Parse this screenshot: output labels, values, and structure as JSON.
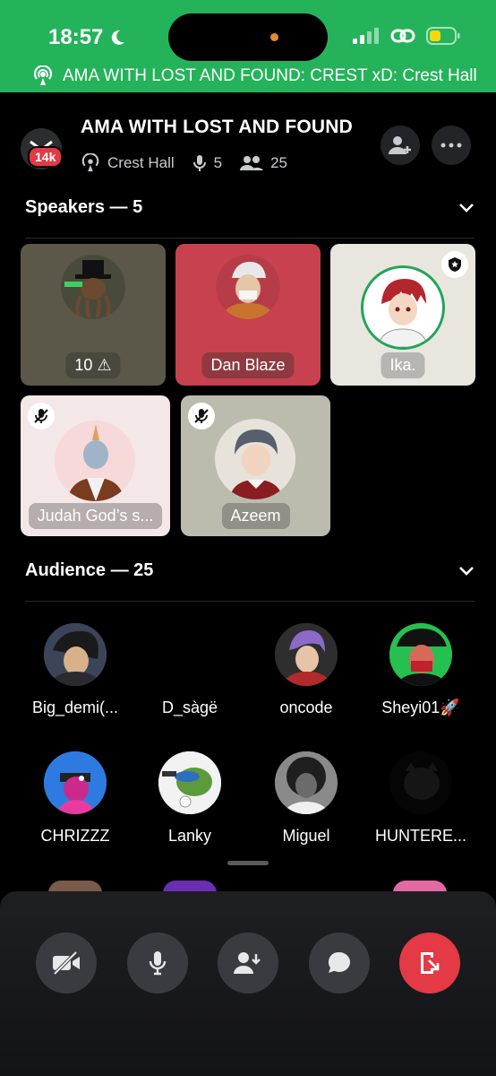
{
  "status_bar": {
    "time": "18:57"
  },
  "banner": {
    "text": "AMA WITH LOST AND FOUND: CREST xD: Crest Hall"
  },
  "header": {
    "server_badge": "14k",
    "title": "AMA WITH LOST AND FOUND",
    "channel": "Crest Hall",
    "speaker_count": "5",
    "listener_count": "25"
  },
  "speakers": {
    "heading": "Speakers — 5",
    "items": [
      {
        "name": "10 ⚠"
      },
      {
        "name": "Dan Blaze"
      },
      {
        "name": "Ika."
      },
      {
        "name": "Judah God’s s..."
      },
      {
        "name": "Azeem"
      }
    ]
  },
  "audience": {
    "heading": "Audience — 25",
    "items": [
      {
        "name": "Big_demi(..."
      },
      {
        "name": "D_sàgë"
      },
      {
        "name": "oncode"
      },
      {
        "name": "Sheyi01🚀"
      },
      {
        "name": "CHRIZZZ"
      },
      {
        "name": "Lanky"
      },
      {
        "name": "Miguel"
      },
      {
        "name": "HUNTERE..."
      }
    ]
  },
  "colors": {
    "banner_green": "#24b35a",
    "leave_red": "#e33a45",
    "badge_red": "#e33a45"
  },
  "icons": [
    "moon-icon",
    "signal-icon",
    "link-icon",
    "battery-icon",
    "stage-icon",
    "mic-icon",
    "people-icon",
    "add-person-icon",
    "more-icon",
    "chevron-down-icon",
    "mic-muted-icon",
    "shield-icon",
    "camera-off-icon",
    "request-speak-icon",
    "chat-icon",
    "leave-icon"
  ]
}
